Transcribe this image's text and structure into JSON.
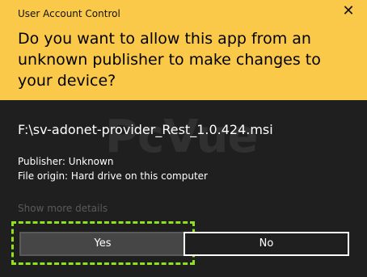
{
  "window": {
    "title": "User Account Control",
    "close_symbol": "✕"
  },
  "header": {
    "question": "Do you want to allow this app from an unknown publisher to make changes to your device?"
  },
  "details": {
    "filename": "F:\\sv-adonet-provider_Rest_1.0.424.msi",
    "publisher": "Publisher: Unknown",
    "origin": "File origin: Hard drive on this computer",
    "show_more": "Show more details"
  },
  "watermark": {
    "text": "PcVue"
  },
  "buttons": {
    "yes": "Yes",
    "no": "No"
  },
  "colors": {
    "header_bg": "#fbc94a",
    "body_bg": "#1f1f1f",
    "highlight": "#8fe31a"
  }
}
